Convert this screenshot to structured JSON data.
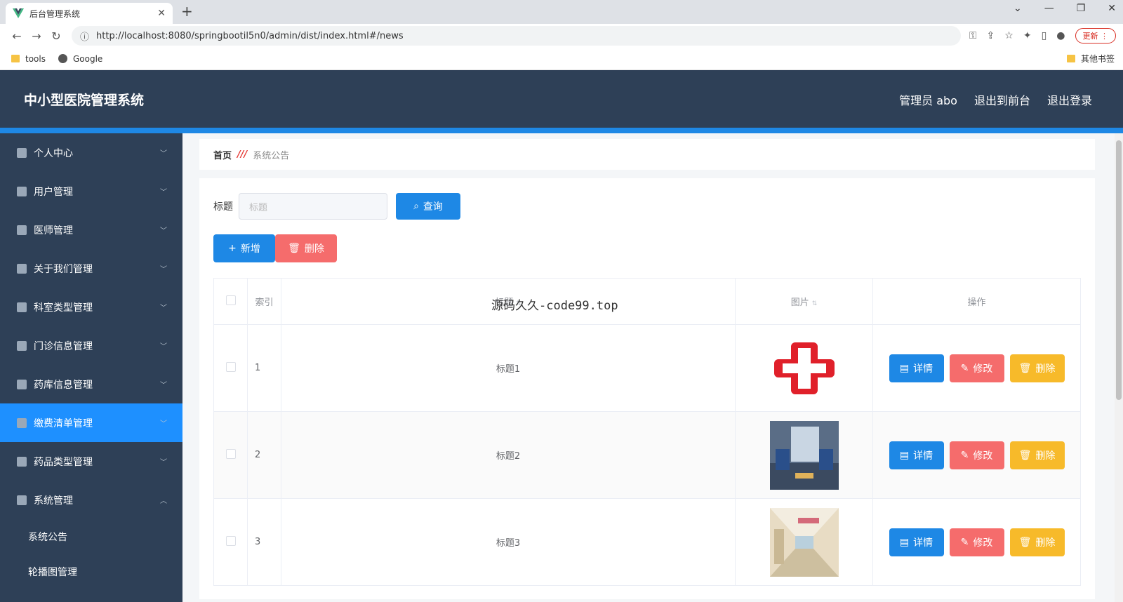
{
  "browser": {
    "tab_title": "后台管理系统",
    "url": "http://localhost:8080/springbootil5n0/admin/dist/index.html#/news",
    "update_label": "更新",
    "bookmarks": [
      "tools",
      "Google"
    ],
    "other_bookmarks": "其他书签"
  },
  "header": {
    "title": "中小型医院管理系统",
    "nav": [
      "管理员 abo",
      "退出到前台",
      "退出登录"
    ]
  },
  "sidebar": {
    "items": [
      {
        "label": "个人中心"
      },
      {
        "label": "用户管理"
      },
      {
        "label": "医师管理"
      },
      {
        "label": "关于我们管理"
      },
      {
        "label": "科室类型管理"
      },
      {
        "label": "门诊信息管理"
      },
      {
        "label": "药库信息管理"
      },
      {
        "label": "缴费清单管理"
      },
      {
        "label": "药品类型管理"
      },
      {
        "label": "系统管理"
      }
    ],
    "sub_items": [
      "系统公告",
      "轮播图管理"
    ]
  },
  "breadcrumb": {
    "home": "首页",
    "current": "系统公告"
  },
  "search": {
    "label": "标题",
    "placeholder": "标题",
    "query_label": "查询"
  },
  "actions": {
    "add_label": "新增",
    "delete_label": "删除"
  },
  "table": {
    "headers": {
      "index": "索引",
      "title": "标题",
      "image": "图片",
      "ops": "操作"
    },
    "rows": [
      {
        "index": "1",
        "title": "标题1"
      },
      {
        "index": "2",
        "title": "标题2"
      },
      {
        "index": "3",
        "title": "标题3"
      }
    ],
    "op_labels": {
      "detail": "详情",
      "edit": "修改",
      "delete": "删除"
    }
  },
  "overlay_text": "源码久久-code99.top",
  "colors": {
    "sidebar": "#2e4057",
    "active": "#1e90ff",
    "primary": "#1e88e5",
    "danger": "#f56c6c",
    "warning": "#f7ba2a"
  }
}
